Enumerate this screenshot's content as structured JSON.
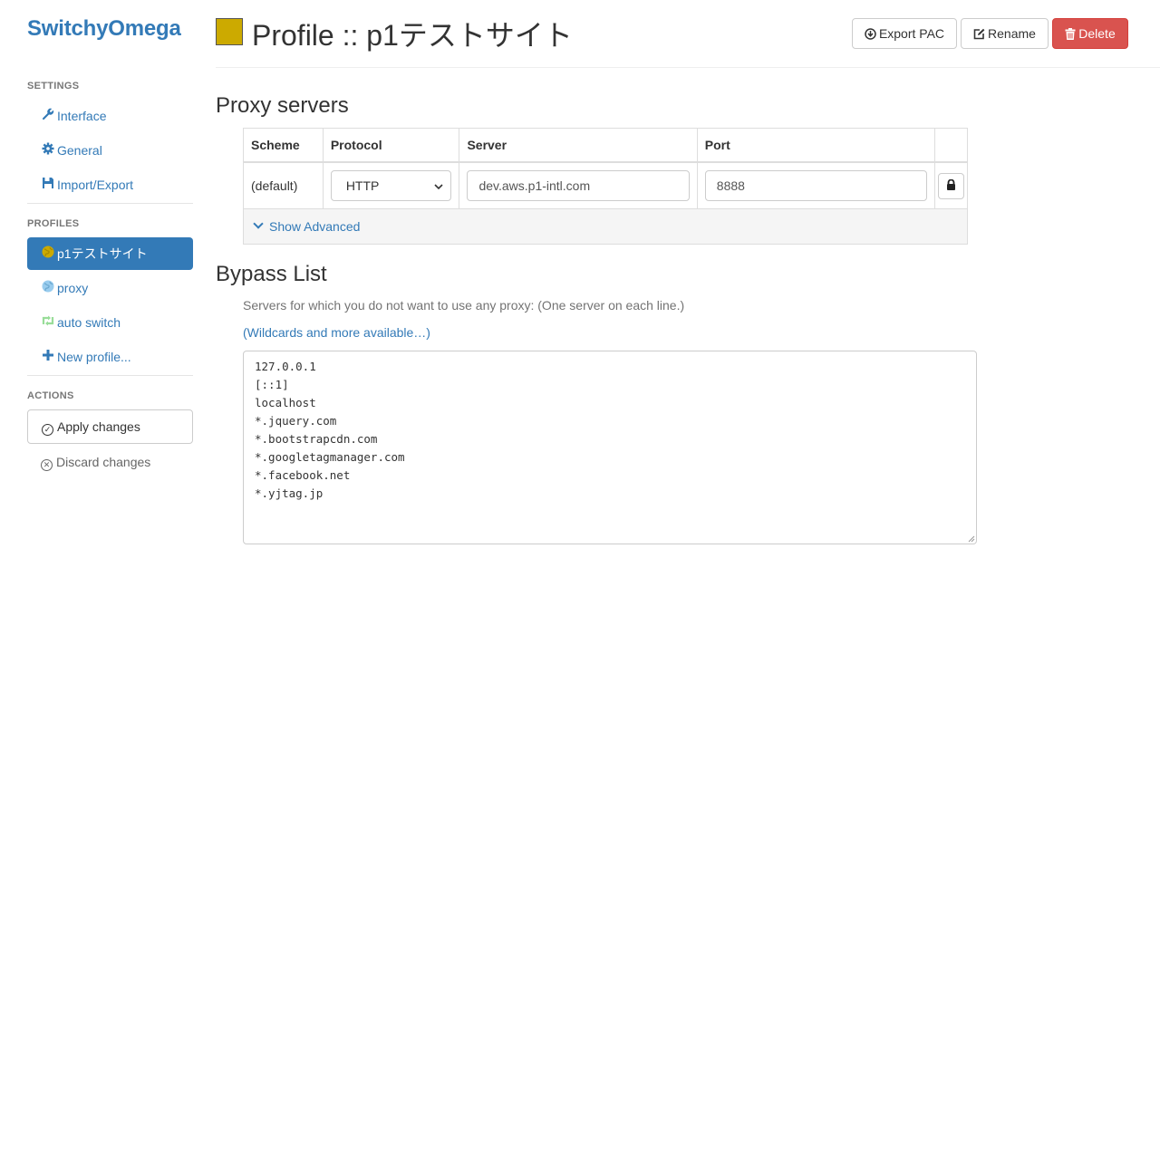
{
  "brand": "SwitchyOmega",
  "sidebar": {
    "settings_header": "SETTINGS",
    "settings_items": [
      {
        "label": "Interface",
        "icon": "wrench-icon"
      },
      {
        "label": "General",
        "icon": "gear-icon"
      },
      {
        "label": "Import/Export",
        "icon": "save-icon"
      }
    ],
    "profiles_header": "PROFILES",
    "profiles": [
      {
        "label": "p1テストサイト",
        "icon": "globe-icon",
        "color": "#ccaa00",
        "active": true
      },
      {
        "label": "proxy",
        "icon": "globe-icon",
        "color": "#99ccee"
      },
      {
        "label": "auto switch",
        "icon": "retweet-icon",
        "color": "#99dd99"
      },
      {
        "label": "New profile...",
        "icon": "plus-icon"
      }
    ],
    "actions_header": "ACTIONS",
    "apply_label": "Apply changes",
    "discard_label": "Discard changes"
  },
  "header": {
    "title": "Profile :: p1テストサイト",
    "profile_color": "#ccaa00",
    "export_label": "Export PAC",
    "rename_label": "Rename",
    "delete_label": "Delete"
  },
  "proxy_servers": {
    "title": "Proxy servers",
    "columns": [
      "Scheme",
      "Protocol",
      "Server",
      "Port"
    ],
    "row": {
      "scheme": "(default)",
      "protocol": "HTTP",
      "server": "dev.aws.p1-intl.com",
      "port": "8888"
    },
    "show_advanced": "Show Advanced"
  },
  "bypass": {
    "title": "Bypass List",
    "help": "Servers for which you do not want to use any proxy: (One server on each line.)",
    "wildcards_link": "(Wildcards and more available…)",
    "text": "127.0.0.1\n[::1]\nlocalhost\n*.jquery.com\n*.bootstrapcdn.com\n*.googletagmanager.com\n*.facebook.net\n*.yjtag.jp"
  }
}
